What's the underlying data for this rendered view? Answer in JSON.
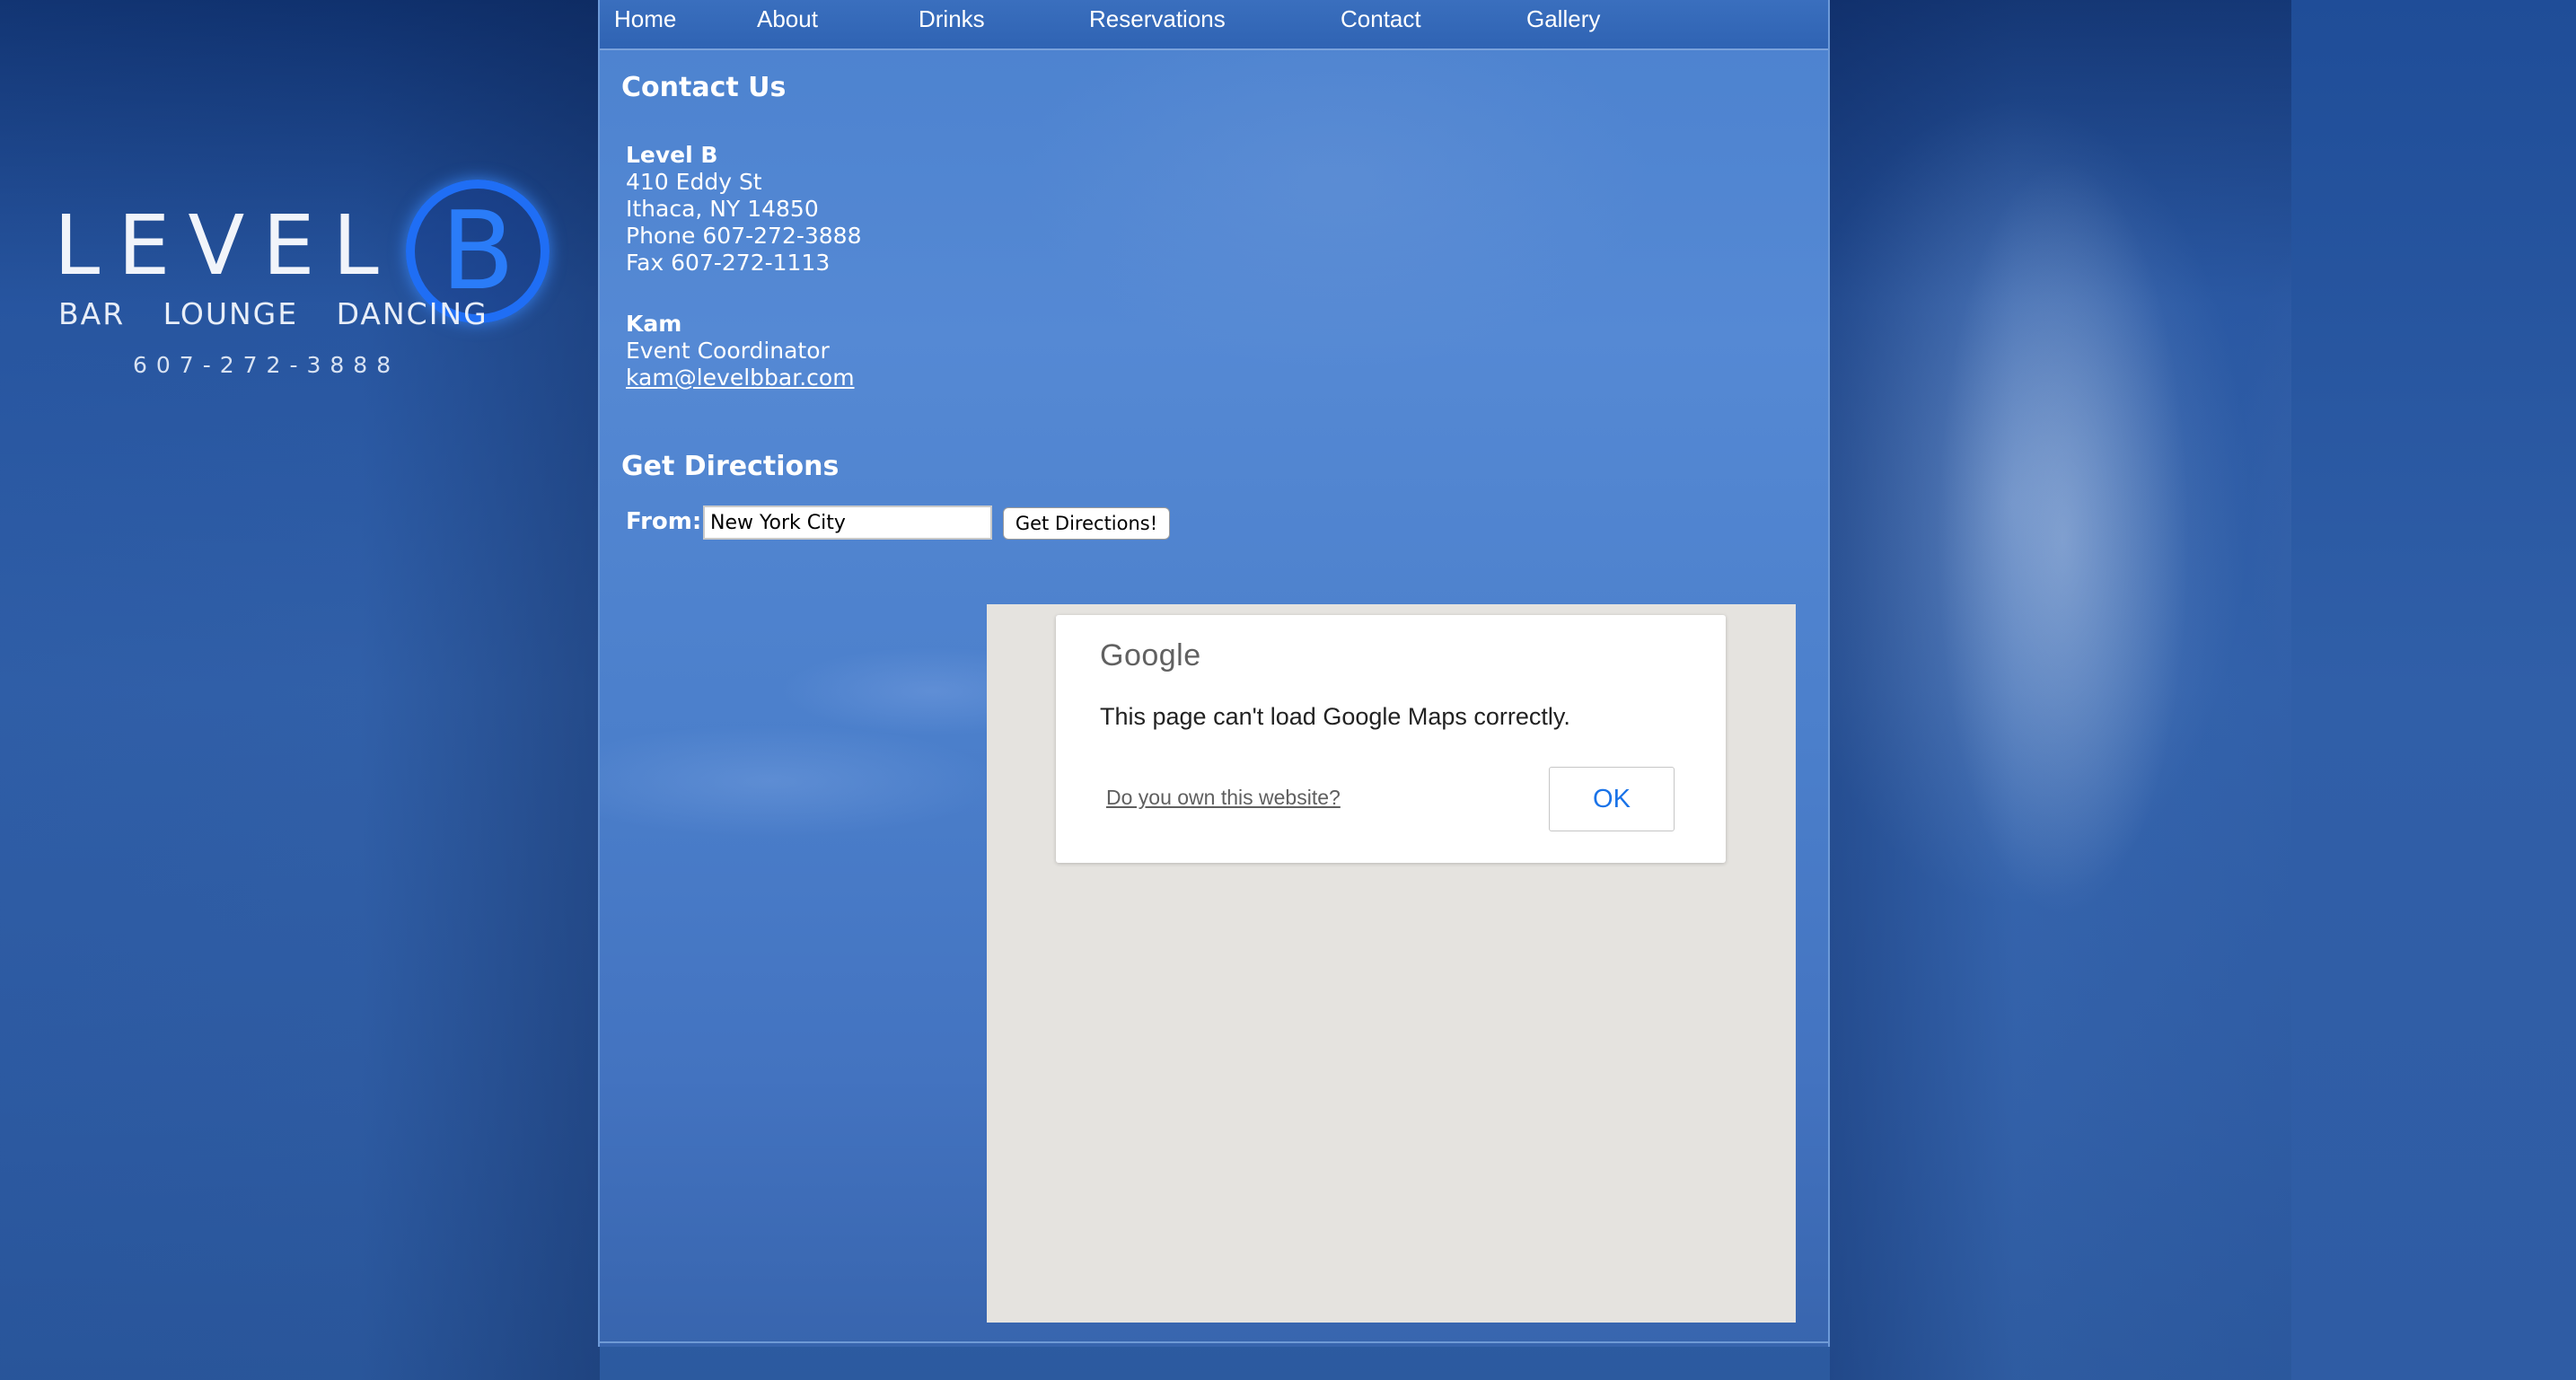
{
  "logo": {
    "word": "LEVEL",
    "letter": "B",
    "tagline": "BAR LOUNGE DANCING",
    "phone": "607-272-3888"
  },
  "nav": {
    "items": [
      {
        "label": "Home"
      },
      {
        "label": "About"
      },
      {
        "label": "Drinks"
      },
      {
        "label": "Reservations"
      },
      {
        "label": "Contact"
      },
      {
        "label": "Gallery"
      }
    ]
  },
  "contact": {
    "heading": "Contact Us",
    "venue": {
      "name": "Level B",
      "street": "410 Eddy St",
      "city": "Ithaca, NY 14850",
      "phone": "Phone 607-272-3888",
      "fax": "Fax 607-272-1113"
    },
    "coordinator": {
      "name": "Kam",
      "title": "Event Coordinator",
      "email": "kam@levelbbar.com"
    }
  },
  "directions": {
    "heading": "Get Directions",
    "from_label": "From:",
    "from_value": "New York City",
    "button_label": "Get Directions!"
  },
  "map": {
    "brand": "Google",
    "message": "This page can't load Google Maps correctly.",
    "own_link": "Do you own this website?",
    "ok_label": "OK"
  }
}
